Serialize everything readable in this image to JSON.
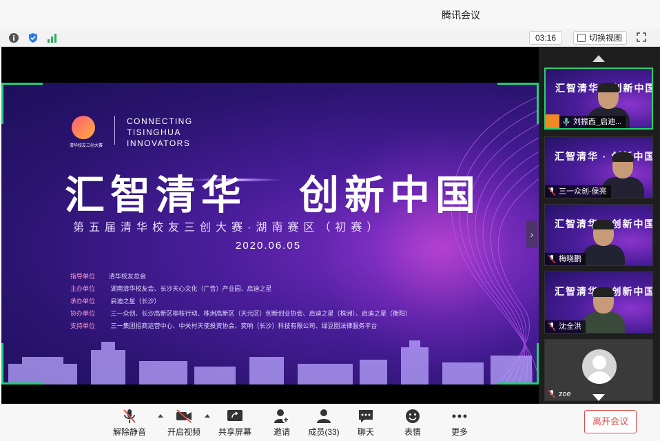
{
  "window": {
    "title": "腾讯会议"
  },
  "infobar": {
    "info_icon": "info-icon",
    "shield_icon": "shield-icon",
    "signal_icon": "signal-icon",
    "timer": "03:16",
    "switch_view_label": "切换视图",
    "fullscreen_icon": "fullscreen-icon"
  },
  "slide": {
    "logo_caption": "清华校友三创大赛",
    "connecting_lines": [
      "CONNECTING",
      "TISINGHUA",
      "INNOVATORS"
    ],
    "headline_left": "汇智清华",
    "headline_right": "创新中国",
    "subhead": "第五届清华校友三创大赛·湖南赛区（初赛）",
    "date": "2020.06.05",
    "orgs": [
      {
        "key": "指导单位",
        "value": "清华校友总会"
      },
      {
        "key": "主办单位",
        "value": " 湖南清华校友会、长沙天心文化（广告）产业园、启迪之星"
      },
      {
        "key": "承办单位",
        "value": " 启迪之星（长沙）"
      },
      {
        "key": "协办单位",
        "value": "  三一众创、长沙高新区柳枝行动、株洲高新区（天元区）创新创业协会、启迪之星（株洲）、启迪之星（衡阳）"
      },
      {
        "key": "支持单位",
        "value": "  三一集团招商运营中心、中关村天使投资协会、奕响（长沙）科技有限公司、绿豆圈法律服务平台"
      }
    ]
  },
  "participants": [
    {
      "name": "刘振西_启迪...",
      "active": true,
      "badge": true
    },
    {
      "name": "三一众创-侯亮",
      "active": false,
      "badge": false
    },
    {
      "name": "梅晓鹏",
      "active": false,
      "badge": false
    },
    {
      "name": "沈全洪",
      "active": false,
      "badge": false
    },
    {
      "name": "zoe",
      "active": false,
      "badge": false
    }
  ],
  "participant_tile_title": "汇智清华 · 创新中国",
  "toolbar": {
    "unmute_label": "解除静音",
    "video_label": "开启视频",
    "share_label": "共享屏幕",
    "invite_label": "邀请",
    "members_label": "成员(33)",
    "chat_label": "聊天",
    "emoji_label": "表情",
    "more_label": "更多",
    "leave_label": "离开会议"
  },
  "colors": {
    "accent_green": "#1fd07a",
    "leave_red": "#e04848",
    "slide_purple": "#4a1d9a"
  }
}
